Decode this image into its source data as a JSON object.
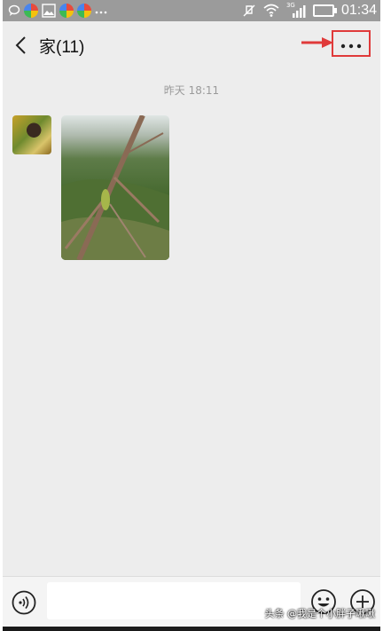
{
  "status_bar": {
    "time": "01:34",
    "network_label": "3G",
    "icons": [
      "chat-bubble-icon",
      "app-icon",
      "image-icon",
      "app-icon",
      "app-icon",
      "more-notifications-icon",
      "mute-icon",
      "wifi-icon",
      "signal-icon",
      "battery-icon"
    ]
  },
  "header": {
    "title": "家(11)",
    "back_icon": "chevron-left-icon",
    "more_icon": "ellipsis-icon"
  },
  "conversation": {
    "timestamp": "昨天 18:11"
  },
  "input_bar": {
    "input_value": "",
    "input_placeholder": "",
    "voice_icon": "voice-icon",
    "emoji_icon": "emoji-icon",
    "plus_icon": "plus-icon"
  },
  "watermark": "头条 @我是个小胖子啾啾",
  "colors": {
    "status_bar": "#9b9b9b",
    "background": "#ededed",
    "annotation": "#e03a3a"
  }
}
